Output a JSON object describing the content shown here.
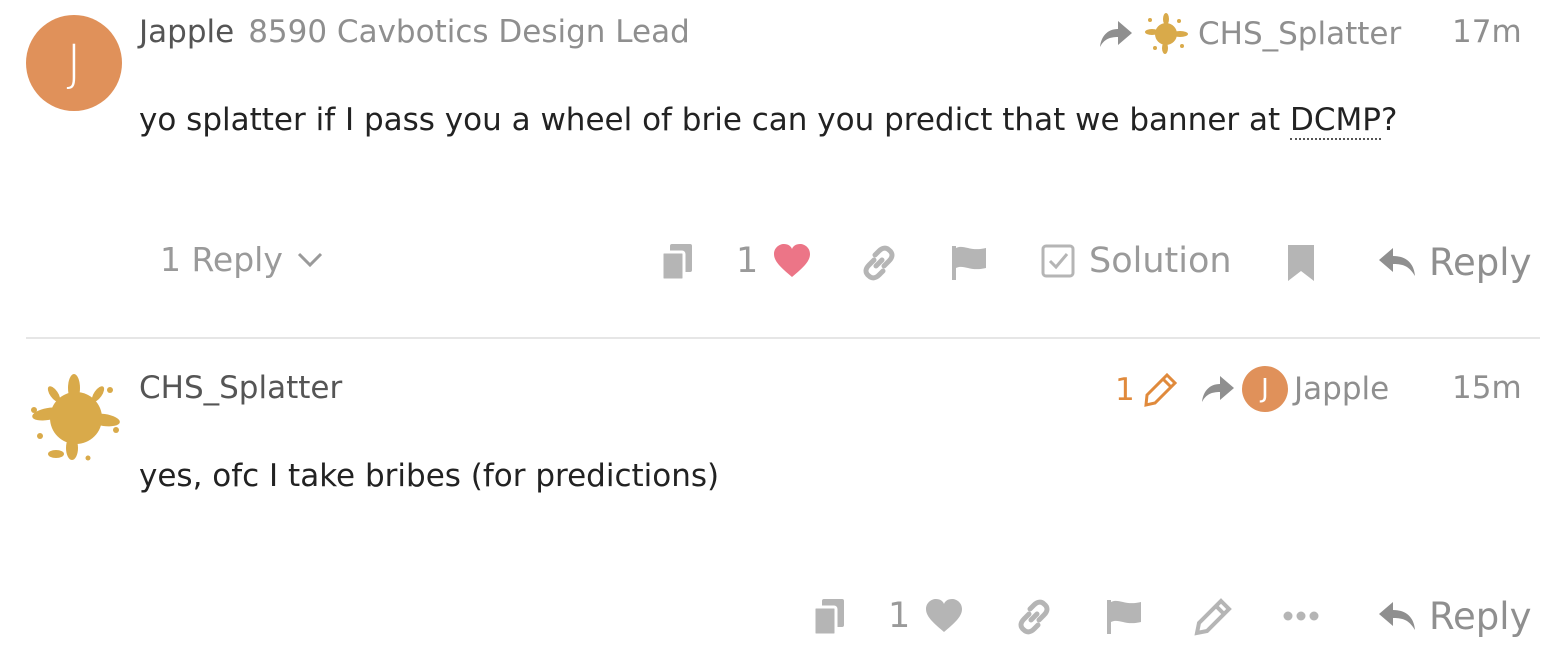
{
  "posts": [
    {
      "avatar_letter": "J",
      "username": "Japple",
      "user_title": "8590 Cavbotics Design Lead",
      "reply_to_user": "CHS_Splatter",
      "time": "17m",
      "body_prefix": "yo splatter if I pass you a wheel of brie can you predict that we banner at ",
      "body_abbr": "DCMP",
      "body_suffix": "?",
      "replies_label": "1 Reply",
      "like_count": "1",
      "solution_label": "Solution",
      "reply_label": "Reply"
    },
    {
      "username": "CHS_Splatter",
      "edit_count": "1",
      "reply_to_avatar_letter": "J",
      "reply_to_user": "Japple",
      "time": "15m",
      "body": "yes, ofc I take bribes (for predictions)",
      "like_count": "1",
      "reply_label": "Reply"
    }
  ],
  "colors": {
    "avatar_orange": "#e0915a",
    "like_red": "#ec7587",
    "edit_orange": "#e08a3c",
    "muted_gray": "#9a9a9a",
    "splatter_gold": "#d9aa4a"
  }
}
